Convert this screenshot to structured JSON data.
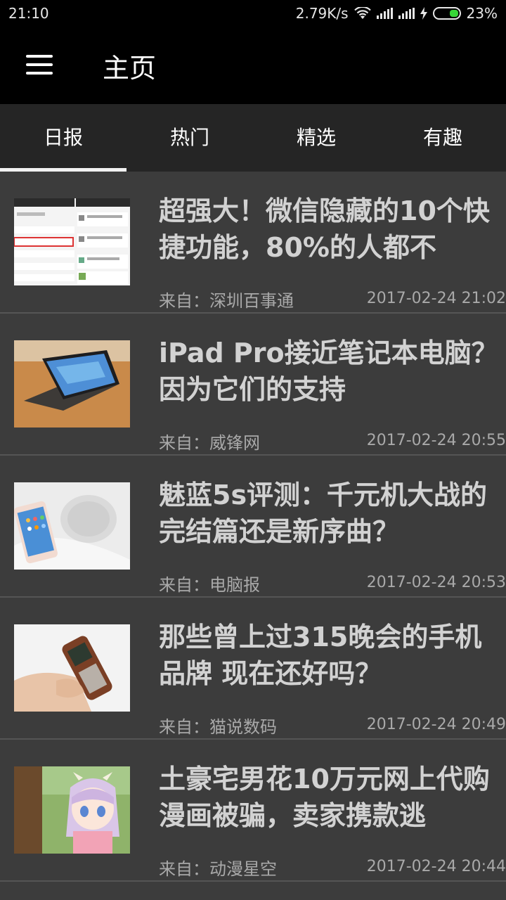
{
  "status_bar": {
    "time": "21:10",
    "speed": "2.79K/s",
    "battery": "23%",
    "icons": [
      "wifi-icon",
      "signal-icon",
      "signal-icon",
      "charging-icon",
      "battery-icon"
    ]
  },
  "app_bar": {
    "title": "主页",
    "menu_icon": "menu-icon"
  },
  "tabs": [
    {
      "label": "日报",
      "active": true
    },
    {
      "label": "热门",
      "active": false
    },
    {
      "label": "精选",
      "active": false
    },
    {
      "label": "有趣",
      "active": false
    }
  ],
  "articles": [
    {
      "title": "超强大！微信隐藏的10个快捷功能，80%的人都不",
      "source": "来自：深圳百事通",
      "time": "2017-02-24 21:02",
      "thumb": "wechat-screenshot-image"
    },
    {
      "title": "iPad Pro接近笔记本电脑？因为它们的支持",
      "source": "来自：威锋网",
      "time": "2017-02-24 20:55",
      "thumb": "ipad-pro-image"
    },
    {
      "title": "魅蓝5s评测：千元机大战的完结篇还是新序曲？",
      "source": "来自：电脑报",
      "time": "2017-02-24 20:53",
      "thumb": "meizu-phone-image"
    },
    {
      "title": "那些曾上过315晚会的手机品牌 现在还好吗？",
      "source": "来自：猫说数码",
      "time": "2017-02-24 20:49",
      "thumb": "nokia-phone-image"
    },
    {
      "title": "土豪宅男花10万元网上代购漫画被骗，卖家携款逃",
      "source": "来自：动漫星空",
      "time": "2017-02-24 20:44",
      "thumb": "anime-girl-image"
    }
  ],
  "colors": {
    "background": "#3c3c3c",
    "app_bar": "#000000",
    "tab_bar": "#252525",
    "indicator": "#f2f2f2"
  }
}
